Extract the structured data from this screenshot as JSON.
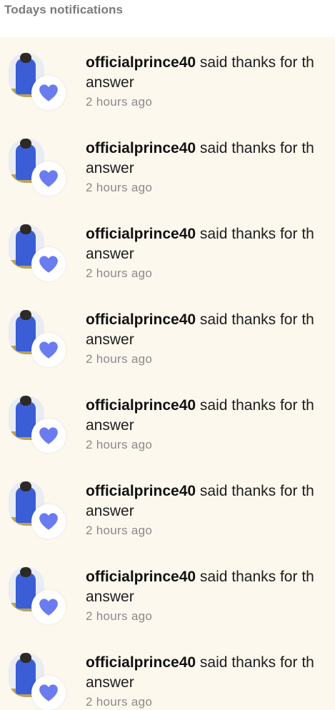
{
  "header": {
    "title": "Todays notifications"
  },
  "colors": {
    "list_background": "#fdf8ee",
    "heart": "#6b7cf0",
    "muted_text": "#8a8a8a"
  },
  "notifications": [
    {
      "username": "officialprince40",
      "message": "said thanks for th",
      "continuation": "answer",
      "time": "2 hours ago",
      "icon": "heart-icon"
    },
    {
      "username": "officialprince40",
      "message": "said thanks for th",
      "continuation": "answer",
      "time": "2 hours ago",
      "icon": "heart-icon"
    },
    {
      "username": "officialprince40",
      "message": "said thanks for th",
      "continuation": "answer",
      "time": "2 hours ago",
      "icon": "heart-icon"
    },
    {
      "username": "officialprince40",
      "message": "said thanks for th",
      "continuation": "answer",
      "time": "2 hours ago",
      "icon": "heart-icon"
    },
    {
      "username": "officialprince40",
      "message": "said thanks for th",
      "continuation": "answer",
      "time": "2 hours ago",
      "icon": "heart-icon"
    },
    {
      "username": "officialprince40",
      "message": "said thanks for th",
      "continuation": "answer",
      "time": "2 hours ago",
      "icon": "heart-icon"
    },
    {
      "username": "officialprince40",
      "message": "said thanks for th",
      "continuation": "answer",
      "time": "2 hours ago",
      "icon": "heart-icon"
    },
    {
      "username": "officialprince40",
      "message": "said thanks for th",
      "continuation": "answer",
      "time": "2 hours ago",
      "icon": "heart-icon"
    }
  ]
}
